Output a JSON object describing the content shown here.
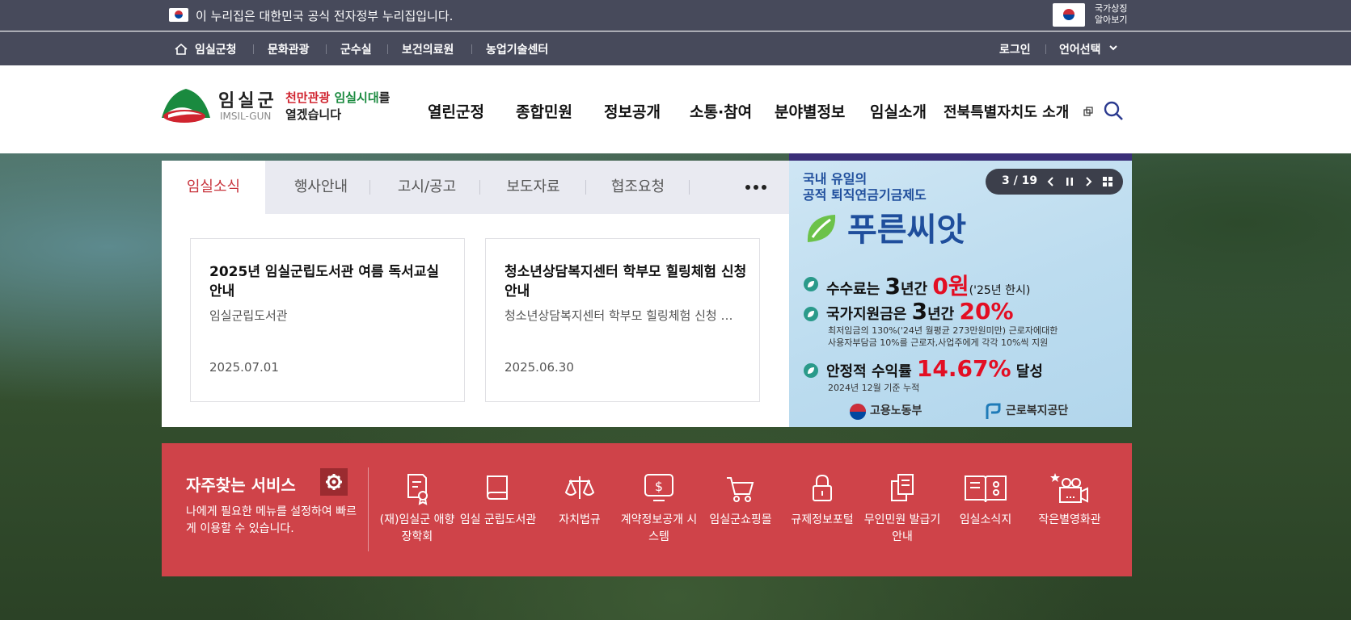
{
  "gov_bar": {
    "text": "이 누리집은 대한민국 공식 전자정부 누리집입니다.",
    "symbol_line1": "국가상징",
    "symbol_line2": "알아보기"
  },
  "util_nav": {
    "left": [
      "임실군청",
      "문화관광",
      "군수실",
      "보건의료원",
      "농업기술센터"
    ],
    "login": "로그인",
    "language": "언어선택"
  },
  "header": {
    "logo_name": "임실군",
    "logo_en": "IMSIL-GUN",
    "slogan_red": "천만관광",
    "slogan_green": "임실시대",
    "slogan_rest1": "를",
    "slogan_line2": "열겠습니다",
    "gnb": [
      "열린군정",
      "종합민원",
      "정보공개",
      "소통·참여",
      "분야별정보",
      "임실소개",
      "전북특별자치도 소개"
    ]
  },
  "news": {
    "tabs": [
      "임실소식",
      "행사안내",
      "고시/공고",
      "보도자료",
      "협조요청"
    ],
    "active_tab": "임실소식",
    "cards": [
      {
        "title": "2025년 임실군립도서관 여름 독서교실 안내",
        "desc": "임실군립도서관",
        "date": "2025.07.01"
      },
      {
        "title": "청소년상담복지센터 학부모 힐링체험 신청 안내",
        "desc": "청소년상담복지센터 학부모 힐링체험 신청 안내",
        "date": "2025.06.30"
      }
    ]
  },
  "banner": {
    "kicker1": "국내 유일의",
    "kicker2": "공적 퇴직연금기금제도",
    "brand": "푸른씨앗",
    "counter": "3 / 19",
    "line1_a": "수수료는 ",
    "line1_b": "3",
    "line1_c": "년간 ",
    "line1_d": "0원",
    "line1_e": "('25년 한시)",
    "line2_a": "국가지원금은 ",
    "line2_b": "3",
    "line2_c": "년간 ",
    "line2_d": "20%",
    "line2_sub1": "최저임금의 130%('24년 월평균 273만원미만) 근로자에대한",
    "line2_sub2": "사용자부담금 10%를 근로자,사업주에게 각각 10%씩 지원",
    "line3_a": "안정적 수익률 ",
    "line3_b": "14.67%",
    "line3_c": " 달성",
    "line3_sub": "2024년 12월 기준 누적",
    "org1": "고용노동부",
    "org2": "근로복지공단",
    "colors": {
      "accent_red": "#e30e23",
      "navy": "#1f4e9c"
    }
  },
  "services": {
    "title": "자주찾는 서비스",
    "desc": "나에게 필요한 메뉴를 설정하여 빠르게 이용할 수 있습니다.",
    "items": [
      {
        "label": "(재)임실군 애향장학회",
        "icon": "certificate-icon"
      },
      {
        "label": "임실 군립도서관",
        "icon": "book-icon"
      },
      {
        "label": "자치법규",
        "icon": "scale-icon"
      },
      {
        "label": "계약정보공개 시스템",
        "icon": "dollar-monitor-icon"
      },
      {
        "label": "임실군쇼핑몰",
        "icon": "cart-icon"
      },
      {
        "label": "규제정보포털",
        "icon": "lock-icon"
      },
      {
        "label": "무인민원 발급기 안내",
        "icon": "documents-icon"
      },
      {
        "label": "임실소식지",
        "icon": "open-book-icon"
      },
      {
        "label": "작은별영화관",
        "icon": "movie-camera-icon"
      }
    ]
  },
  "colors": {
    "gov_bar": "#474a5b",
    "services_bg": "#cf4349",
    "active_tab": "#c8333c"
  }
}
